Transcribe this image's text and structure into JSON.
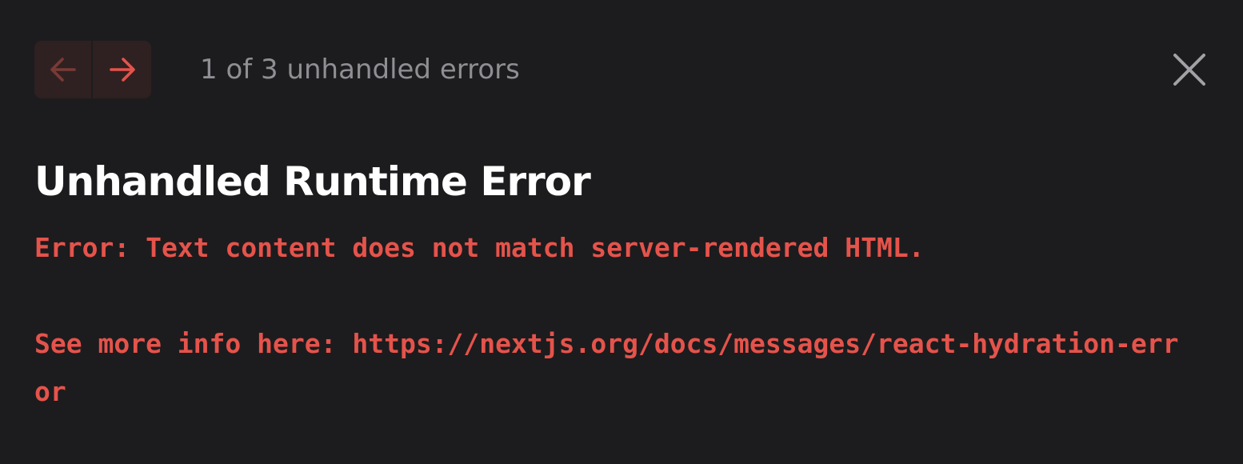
{
  "navigation": {
    "prev_icon": "arrow-left-icon",
    "next_icon": "arrow-right-icon",
    "pagination_text": "1 of 3 unhandled errors",
    "close_icon": "close-icon"
  },
  "error": {
    "title": "Unhandled Runtime Error",
    "message_line1": "Error: Text content does not match server-rendered HTML.",
    "message_line2": "See more info here: https://nextjs.org/docs/messages/react-hydration-error"
  },
  "colors": {
    "background": "#1c1c1e",
    "nav_background": "#2f2121",
    "accent_red": "#e5534b",
    "muted_text": "#8e8e93",
    "title_text": "#ffffff"
  }
}
